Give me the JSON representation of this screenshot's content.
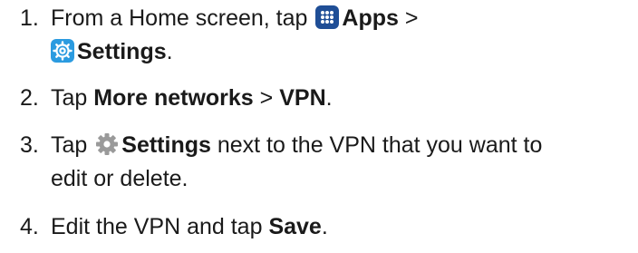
{
  "steps": [
    {
      "number": "1.",
      "pre": "From a Home screen, tap",
      "apps_label": "Apps",
      "sep": ">",
      "settings_label": "Settings",
      "end": ".",
      "icons": [
        "apps-icon",
        "settings-icon"
      ]
    },
    {
      "number": "2.",
      "pre": "Tap",
      "more_networks": "More networks",
      "sep": ">",
      "vpn": "VPN",
      "end": "."
    },
    {
      "number": "3.",
      "pre": "Tap",
      "settings_label": "Settings",
      "line1_rest": "next to the VPN that you want to",
      "line2": "edit or delete.",
      "icons": [
        "gear-icon"
      ]
    },
    {
      "number": "4.",
      "pre": "Edit the VPN and tap",
      "save": "Save",
      "end": "."
    }
  ],
  "colors": {
    "text": "#1a1a1a",
    "apps_icon_bg": "#1f4e96",
    "settings_icon_bg": "#2b9be0",
    "gear_icon": "#9a9a9a"
  }
}
